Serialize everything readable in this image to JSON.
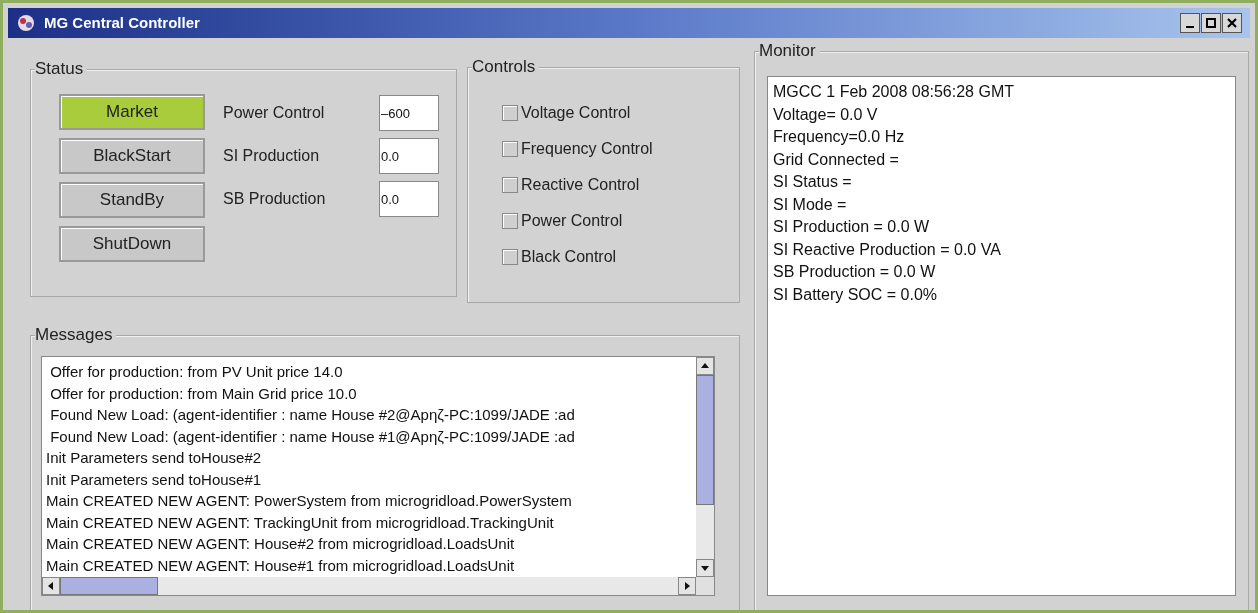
{
  "window": {
    "title": "MG Central Controller"
  },
  "status": {
    "title": "Status",
    "modes": [
      {
        "label": "Market",
        "selected": true
      },
      {
        "label": "BlackStart",
        "selected": false
      },
      {
        "label": "StandBy",
        "selected": false
      },
      {
        "label": "ShutDown",
        "selected": false
      }
    ],
    "fields": [
      {
        "label": "Power Control",
        "value": "–600"
      },
      {
        "label": "SI Production",
        "value": "0.0"
      },
      {
        "label": "SB Production",
        "value": "0.0"
      }
    ]
  },
  "controls": {
    "title": "Controls",
    "items": [
      {
        "label": "Voltage Control",
        "checked": false
      },
      {
        "label": "Frequency Control",
        "checked": false
      },
      {
        "label": "Reactive Control",
        "checked": false
      },
      {
        "label": "Power Control",
        "checked": false
      },
      {
        "label": "Black Control",
        "checked": false
      }
    ]
  },
  "messages": {
    "title": "Messages",
    "lines": [
      " Offer for production: from PV Unit price 14.0",
      " Offer for production: from Main Grid price 10.0",
      " Found New Load: (agent-identifier : name House #2@Apηζ-PC:1099/JADE :ad",
      " Found New Load: (agent-identifier : name House #1@Apηζ-PC:1099/JADE :ad",
      "Init Parameters send toHouse#2",
      "Init Parameters send toHouse#1",
      "Main CREATED NEW AGENT: PowerSystem from microgridload.PowerSystem",
      "Main CREATED NEW AGENT: TrackingUnit from microgridload.TrackingUnit",
      "Main CREATED NEW AGENT: House#2 from microgridload.LoadsUnit",
      "Main CREATED NEW AGENT: House#1 from microgridload.LoadsUnit"
    ]
  },
  "monitor": {
    "title": "Monitor",
    "lines": [
      "MGCC 1 Feb 2008 08:56:28 GMT",
      "Voltage= 0.0 V",
      "Frequency=0.0 Hz",
      "Grid Connected =",
      "SI Status =",
      "SI Mode =",
      "SI Production = 0.0 W",
      "SI Reactive Production = 0.0 VA",
      "SB Production = 0.0 W",
      "SI Battery SOC = 0.0%"
    ]
  }
}
